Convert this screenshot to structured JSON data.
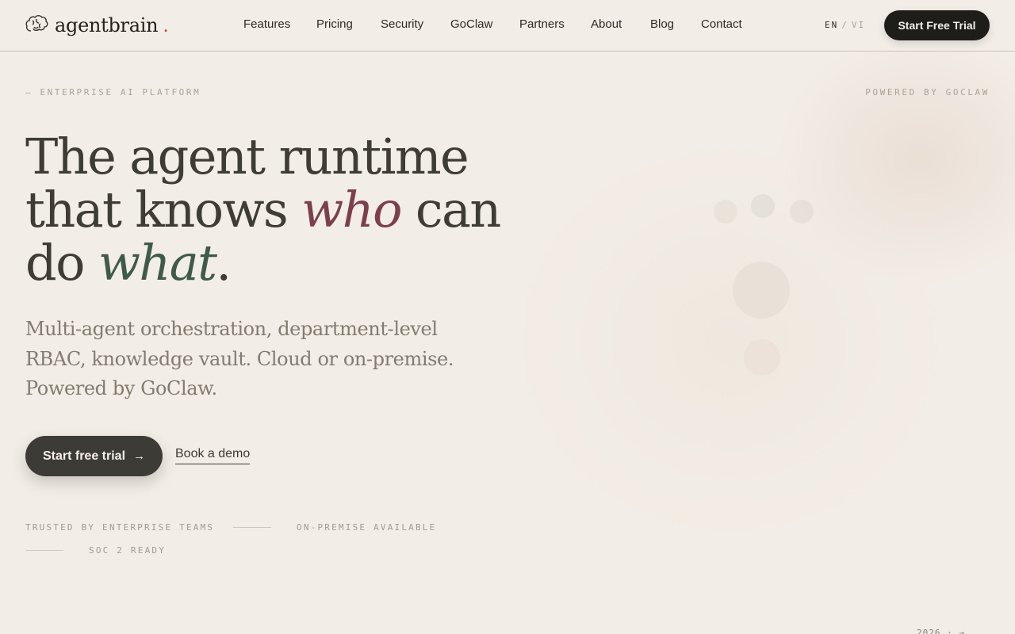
{
  "brand": {
    "name": "agentbrain",
    "dot": ".",
    "accent": "#c2563d",
    "icon": "brain-icon"
  },
  "nav": {
    "items": [
      {
        "label": "Features"
      },
      {
        "label": "Pricing"
      },
      {
        "label": "Security"
      },
      {
        "label": "GoClaw"
      },
      {
        "label": "Partners"
      },
      {
        "label": "About"
      },
      {
        "label": "Blog"
      },
      {
        "label": "Contact"
      }
    ]
  },
  "language": {
    "current": "EN",
    "separator": "/",
    "other": "VI"
  },
  "header_cta": {
    "label": "Start Free Trial"
  },
  "hero": {
    "eyebrow_left": "— ENTERPRISE AI PLATFORM",
    "eyebrow_right": "POWERED BY GOCLAW",
    "headline": {
      "part1": "The agent runtime that knows ",
      "who": "who",
      "part2": " can do ",
      "what": "what",
      "end": "."
    },
    "subheadline": "Multi-agent orchestration, department-level RBAC, knowledge vault. Cloud or on-premise. Powered by GoClaw.",
    "primary_cta": "Start free trial",
    "primary_cta_icon": "arrow-right-icon",
    "secondary_cta": "Book a demo",
    "trust": [
      "TRUSTED BY ENTERPRISE TEAMS",
      "ON-PREMISE AVAILABLE",
      "SOC 2 READY"
    ]
  },
  "footer_hint": "2026 ·  →",
  "colors": {
    "background": "#f2ede6",
    "text": "#3e3c37",
    "who": "#7b4049",
    "what": "#3f5a48",
    "button": "#1e1d1a"
  }
}
